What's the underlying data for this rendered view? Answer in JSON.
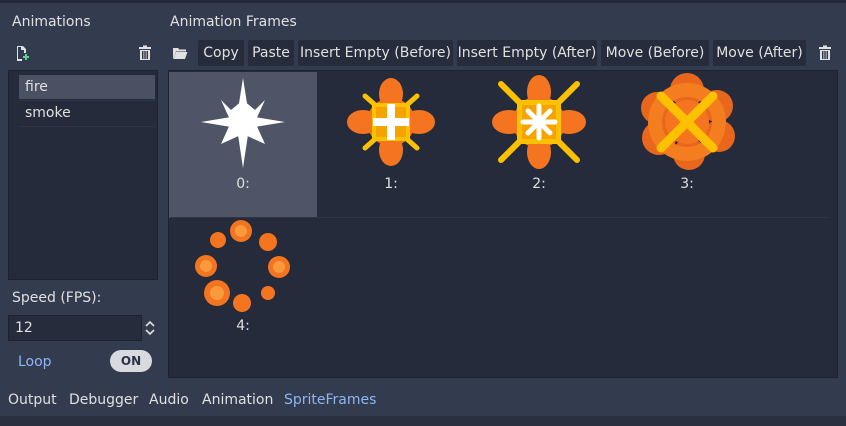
{
  "animations_panel": {
    "title": "Animations",
    "new_icon": "new-animation-icon",
    "delete_icon": "trash-icon",
    "items": [
      {
        "label": "fire",
        "selected": true
      },
      {
        "label": "smoke",
        "selected": false
      }
    ],
    "speed_label": "Speed (FPS):",
    "speed_value": "12",
    "loop_label": "Loop",
    "loop_toggle": "ON"
  },
  "frames_panel": {
    "title": "Animation Frames",
    "load_icon": "folder-open-icon",
    "toolbar": {
      "copy": "Copy",
      "paste": "Paste",
      "insert_before": "Insert Empty (Before)",
      "insert_after": "Insert Empty (After)",
      "move_before": "Move (Before)",
      "move_after": "Move (After)"
    },
    "delete_icon": "trash-icon",
    "frames": [
      {
        "label": "0:",
        "selected": true
      },
      {
        "label": "1:",
        "selected": false
      },
      {
        "label": "2:",
        "selected": false
      },
      {
        "label": "3:",
        "selected": false
      },
      {
        "label": "4:",
        "selected": false
      }
    ]
  },
  "bottom_tabs": [
    {
      "label": "Output",
      "active": false
    },
    {
      "label": "Debugger",
      "active": false
    },
    {
      "label": "Audio",
      "active": false
    },
    {
      "label": "Animation",
      "active": false
    },
    {
      "label": "SpriteFrames",
      "active": true
    }
  ],
  "colors": {
    "background": "#333b4f",
    "panel": "#252b3a",
    "selected": "#4f5566",
    "accent": "#8eb6f3",
    "fire_orange": "#f4741f",
    "fire_yellow": "#fcc100",
    "fire_white": "#ffffff"
  }
}
